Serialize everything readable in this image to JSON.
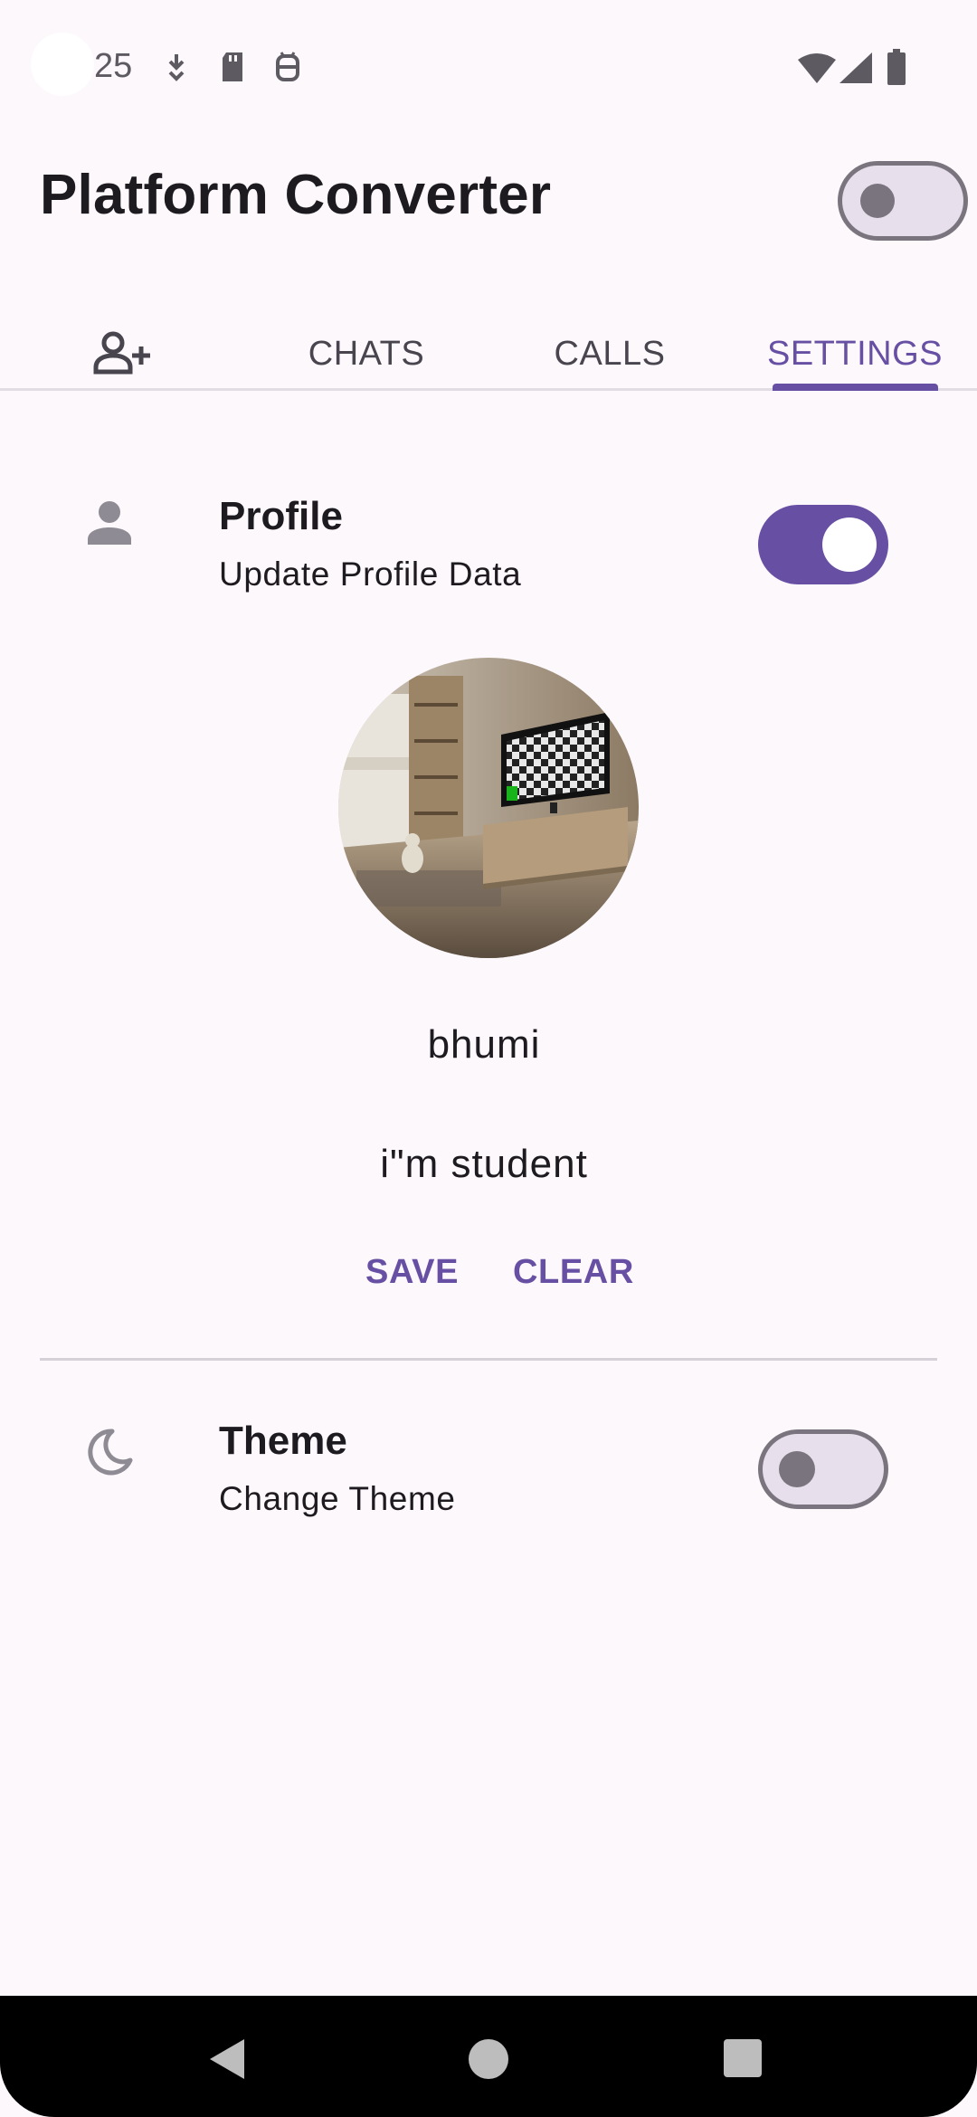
{
  "status_bar": {
    "time": "25"
  },
  "app_bar": {
    "title": "Platform Converter",
    "dark_mode_switch_on": false
  },
  "tabs": [
    {
      "label": "",
      "icon": "add-person-icon",
      "active": false
    },
    {
      "label": "CHATS",
      "active": false
    },
    {
      "label": "CALLS",
      "active": false
    },
    {
      "label": "SETTINGS",
      "active": true
    }
  ],
  "profile_section": {
    "title": "Profile",
    "subtitle": "Update Profile Data",
    "icon": "person-icon",
    "switch_on": true,
    "name": "bhumi",
    "bio": "i\"m student",
    "save_label": "SAVE",
    "clear_label": "CLEAR"
  },
  "theme_section": {
    "title": "Theme",
    "subtitle": "Change Theme",
    "icon": "moon-icon",
    "switch_on": false
  },
  "colors": {
    "accent": "#6750a4",
    "background": "#fdf8fc",
    "outline": "#79747e"
  }
}
